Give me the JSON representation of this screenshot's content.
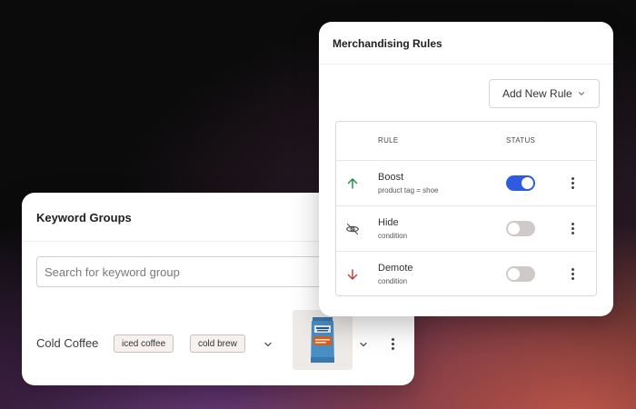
{
  "keyword_groups": {
    "title": "Keyword Groups",
    "search_placeholder": "Search for keyword group",
    "rows": [
      {
        "name": "Cold Coffee",
        "tags": [
          "iced coffee",
          "cold brew"
        ],
        "thumbnail_icon": "coffee-bag-icon"
      }
    ]
  },
  "merchandising_rules": {
    "title": "Merchandising Rules",
    "add_button_label": "Add New Rule",
    "columns": {
      "rule": "RULE",
      "status": "STATUS"
    },
    "rules": [
      {
        "name": "Boost",
        "condition": "product tag = shoe",
        "icon": "arrow-up-icon",
        "enabled": true
      },
      {
        "name": "Hide",
        "condition": "condition",
        "icon": "eye-off-icon",
        "enabled": false
      },
      {
        "name": "Demote",
        "condition": "condition",
        "icon": "arrow-down-icon",
        "enabled": false
      }
    ]
  },
  "colors": {
    "boost_green": "#1e8a3c",
    "demote_red": "#c0392b",
    "toggle_on": "#2f5be0",
    "toggle_off": "#cfcac7",
    "bag_blue": "#4a8fc4",
    "bag_orange": "#d9601e"
  }
}
